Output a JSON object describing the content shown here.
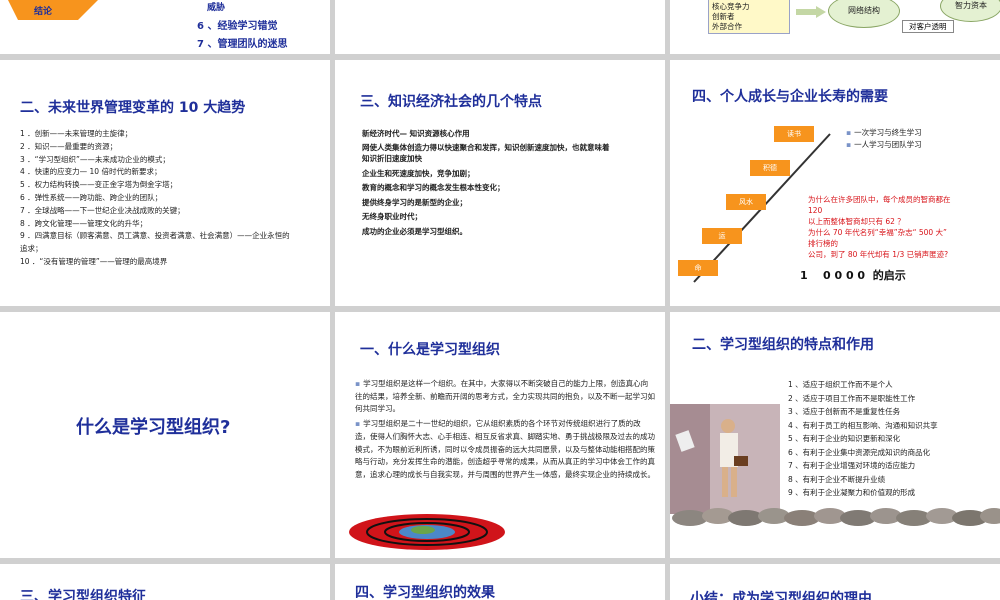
{
  "slide1": {
    "tag": "结论",
    "items": [
      "6 、经验学习错觉",
      "7 、管理团队的迷思"
    ],
    "partial": "威胁"
  },
  "slide3": {
    "box_lines": [
      "核心竞争力",
      "创新者",
      "外部合作"
    ],
    "oval1": "网络结构",
    "oval2": "智力资本",
    "label": "对客户透明"
  },
  "slide4": {
    "title": "二、未来世界管理变革的 10 大趋势",
    "items": [
      "1 ．创新——未来管理的主旋律；",
      "2 ．知识——最重要的资源；",
      "3 ．“学习型组织”——未来成功企业的模式；",
      "4 ．快速的应变力— 10 倍时代的新要求；",
      "5 ．权力结构转换——变正金字塔为倒金字塔；",
      "6 ．弹性系统——跨功能、跨企业的团队；",
      "7 ．全球战略——下一世纪企业决战成败的关键；",
      "8 ．跨文化管理——管理文化的升华；",
      "9 ．四满意目标（顾客满意、员工满意、投资者满意、社会满意）——企业永恒的",
      "     追求；",
      "10 ．“没有管理的管理”——管理的最高境界"
    ]
  },
  "slide5": {
    "title": "三、知识经济社会的几个特点",
    "items": [
      "新经济时代— 知识资源核心作用",
      "网使人类集体创造力得以快速聚合和发挥，知识创新速度加快，也就意味着",
      "      知识折旧速度加快",
      "企业生和死速度加快，竞争加剧；",
      "教育的概念和学习的概念发生根本性变化；",
      "提供终身学习的是新型的企业；",
      "无终身职业时代；",
      "成功的企业必须是学习型组织。"
    ]
  },
  "slide6": {
    "title": "四、个人成长与企业长寿的需要",
    "stairs": [
      "读书",
      "积德",
      "风水",
      "运",
      "命"
    ],
    "bullets": [
      "一次学习与终生学习",
      "一人学习与团队学习"
    ],
    "red_lines": [
      "为什么在许多团队中，每个成员的智商都在",
      "      120",
      "以上而整体智商却只有 62 ？",
      "为什么 70 年代名列“幸福”杂志“ 500 大”",
      "      排行榜的",
      "公司，到了 80 年代却有 1/3 已销声匿迹?"
    ],
    "bottom": "1    0 0 0 0  的启示"
  },
  "slide7": {
    "question": "什么是学习型组织?"
  },
  "slide8": {
    "title": "一、什么是学习型组织",
    "paras": [
      "学习型组织是这样一个组织。在其中，大家得以不断突破自己的能力上限，创造真心向往的结果，培养全新、前瞻而开阔的思考方式，全力实现共同的抱负，以及不断一起学习如何共同学习。",
      "学习型组织是二十一世纪的组织，它从组织素质的各个环节对传统组织进行了质的改造，使得人们胸怀大志、心手相连、相互反省求真、脚踏实地、勇于挑战极限及过去的成功模式，不为眼前近利所诱，同时以令成员振奋的远大共同愿景，以及与整体动能相搭配的策略与行动，充分发挥生命的潜能，创造超乎寻常的成果，从而从真正的学习中体会工作的真意，追求心理的成长与自我实现，并与周围的世界产生一体感，最终实现企业的持续成长。"
    ]
  },
  "slide9": {
    "title": "二、学习型组织的特点和作用",
    "items": [
      "1 、适应于组织工作而不是个人",
      "2 、适应于项目工作而不是职能性工作",
      "3 、适应于创新而不是重复性任务",
      "4 、有利于员工的相互影响、沟通和知识共享",
      "5 、有利于企业的知识更新和深化",
      "6 、有利于企业集中资源完成知识的商品化",
      "7 、有利于企业增强对环境的适应能力",
      "8 、有利于企业不断提升业绩",
      "9 、有利于企业凝聚力和价值观的形成"
    ]
  },
  "slide10": {
    "title": "三、学习型组织特征"
  },
  "slide11": {
    "title": "四、学习型组织的效果"
  },
  "slide12": {
    "title": "小结：成为学习型组织的理由"
  }
}
